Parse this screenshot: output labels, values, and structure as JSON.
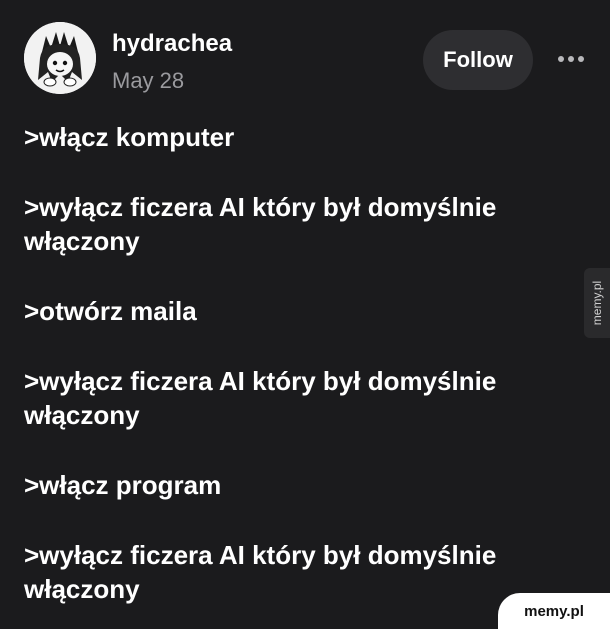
{
  "author": {
    "username": "hydrachea",
    "date": "May 28"
  },
  "actions": {
    "follow_label": "Follow",
    "more_icon": "more-horizontal-icon"
  },
  "post": {
    "lines": [
      ">włącz komputer",
      ">wyłącz ficzera AI który był domyślnie włączony",
      ">otwórz maila",
      ">wyłącz ficzera AI który był domyślnie włączony",
      ">włącz program",
      ">wyłącz ficzera AI który był domyślnie włączony"
    ]
  },
  "watermarks": {
    "side": "memy.pl",
    "corner": "memy.pl"
  },
  "colors": {
    "background": "#1b1b1d",
    "text": "#ffffff",
    "muted": "#9a9a9e",
    "button": "#2e2e31"
  }
}
